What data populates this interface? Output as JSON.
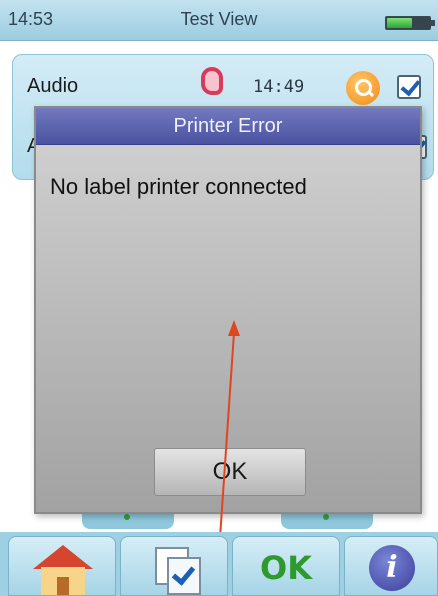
{
  "status_bar": {
    "time": "14:53",
    "title": "Test View",
    "battery_level": 0.6
  },
  "list": {
    "rows": [
      {
        "label": "Audio",
        "time": "14:49"
      },
      {
        "label": "A"
      }
    ]
  },
  "dialog": {
    "title": "Printer Error",
    "message": "No label printer connected",
    "ok_label": "OK"
  },
  "toolbar": {
    "ok_label": "OK",
    "info_glyph": "i"
  },
  "icons": [
    "battery-icon",
    "ear-icon",
    "search-icon",
    "checkbox-icon",
    "home-icon",
    "checklist-icon",
    "info-icon"
  ],
  "colors": {
    "dialog_title_bg": "#5a61ad",
    "toolbar_ok": "#2e9a2e",
    "arrow": "#e0461e"
  }
}
